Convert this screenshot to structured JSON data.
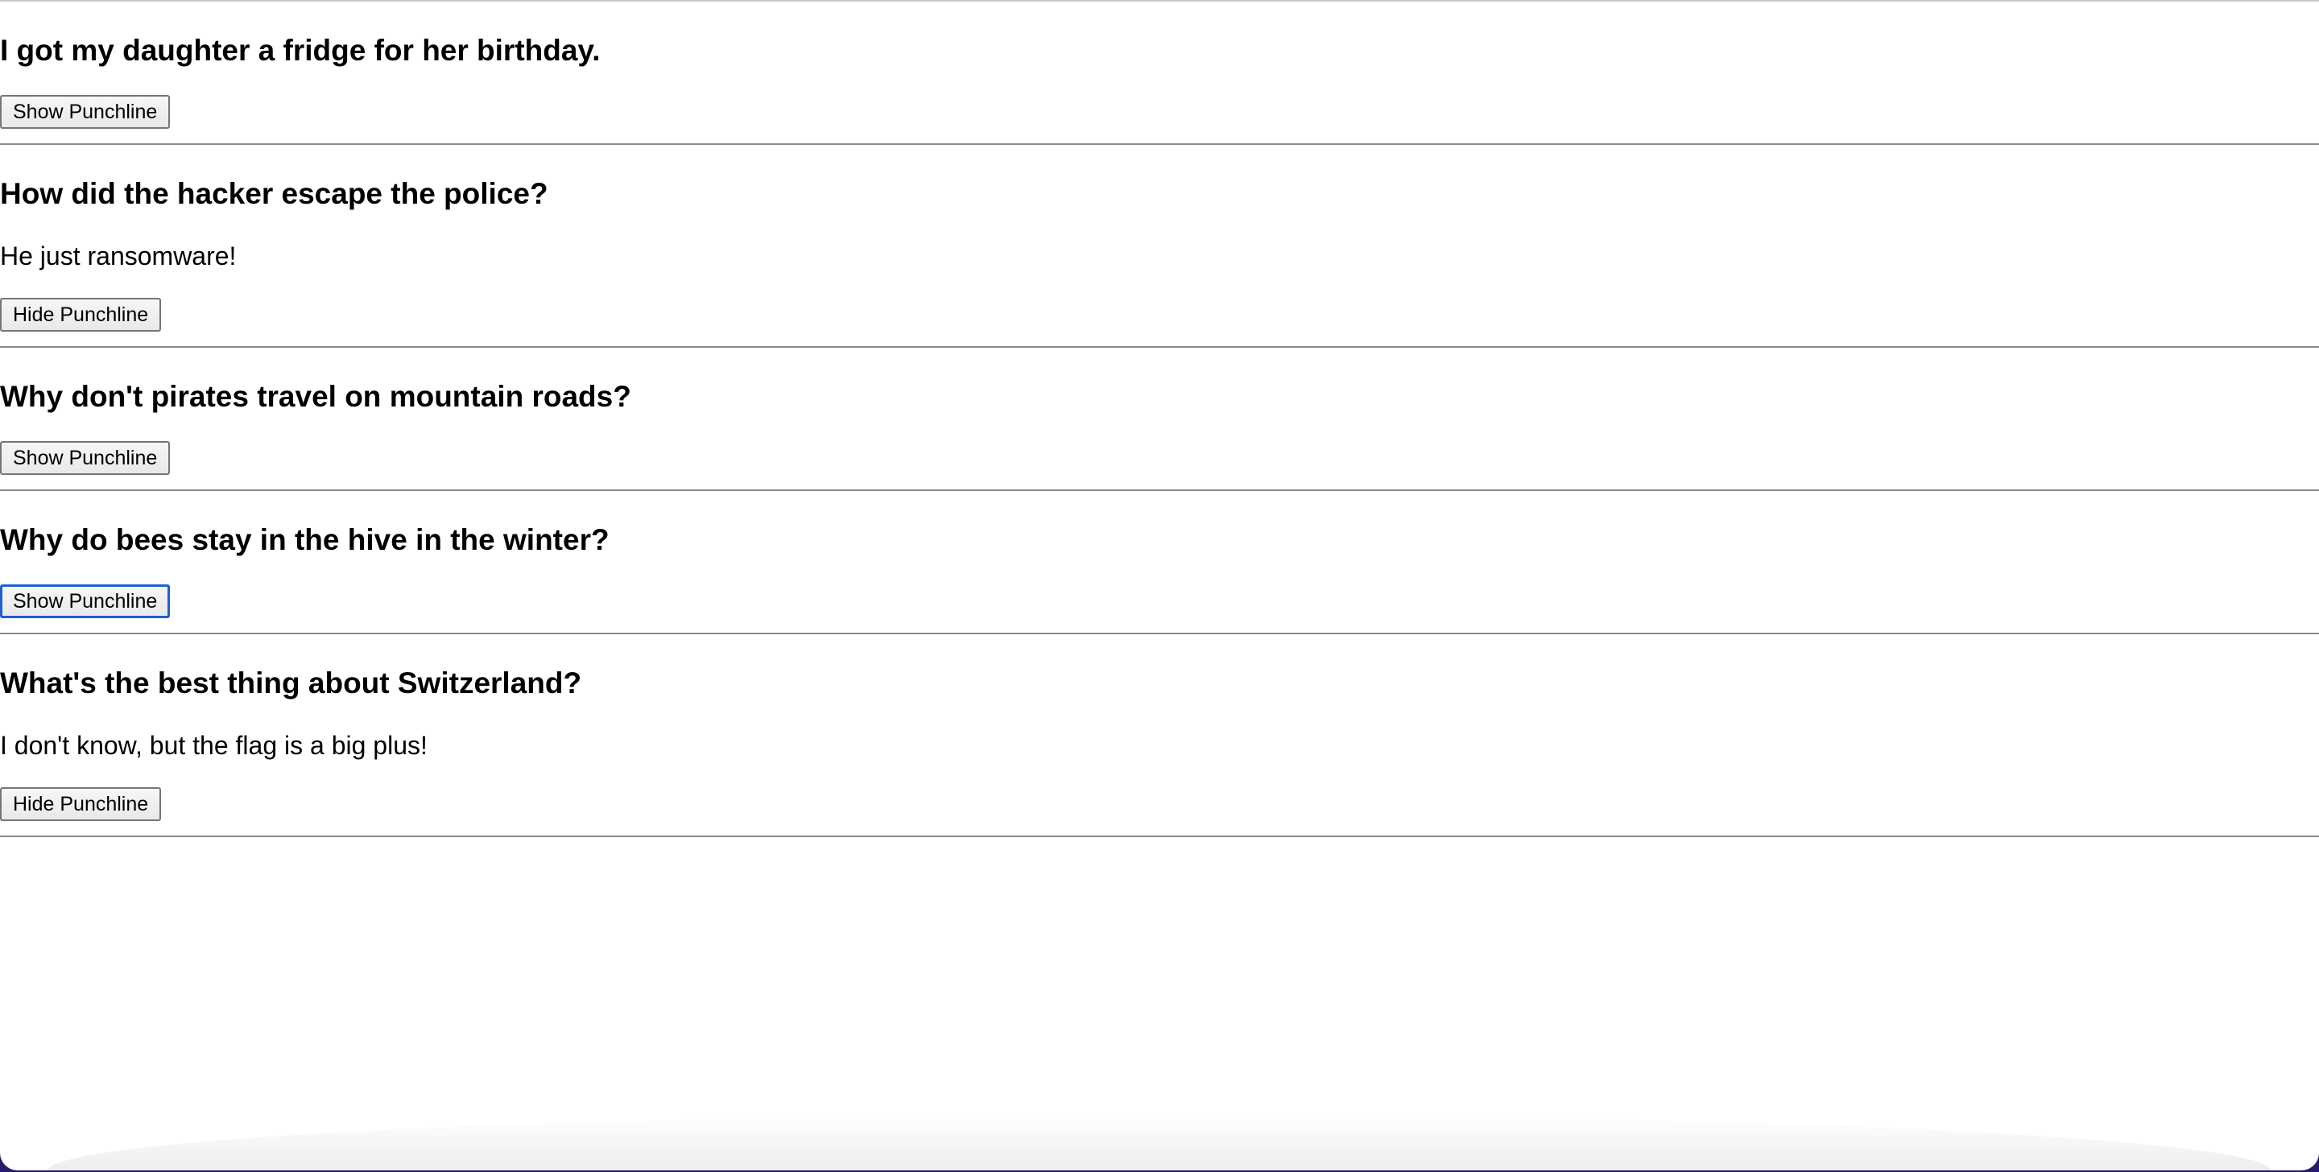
{
  "jokes": [
    {
      "setup": "I got my daughter a fridge for her birthday.",
      "punchline": "",
      "button_label": "Show Punchline"
    },
    {
      "setup": "How did the hacker escape the police?",
      "punchline": "He just ransomware!",
      "button_label": "Hide Punchline"
    },
    {
      "setup": "Why don't pirates travel on mountain roads?",
      "punchline": "",
      "button_label": "Show Punchline"
    },
    {
      "setup": "Why do bees stay in the hive in the winter?",
      "punchline": "",
      "button_label": "Show Punchline"
    },
    {
      "setup": "What's the best thing about Switzerland?",
      "punchline": "I don't know, but the flag is a big plus!",
      "button_label": "Hide Punchline"
    }
  ]
}
